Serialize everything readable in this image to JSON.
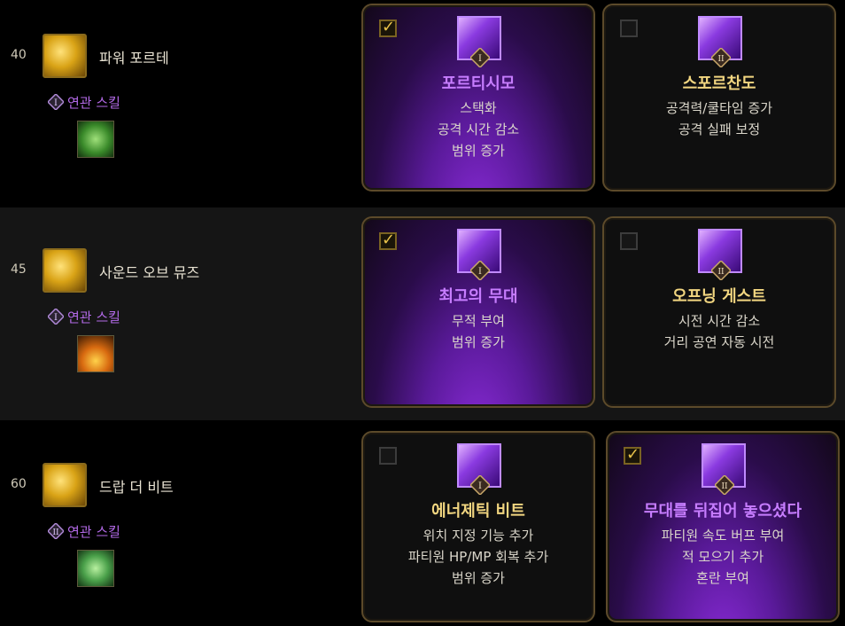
{
  "rows": [
    {
      "level": "40",
      "skill_name": "파워 포르테",
      "related_label": "연관 스킬",
      "related_badge": "I",
      "cards": [
        {
          "selected": true,
          "badge": "I",
          "title": "포르티시모",
          "lines": [
            "스택화",
            "공격 시간 감소",
            "범위 증가"
          ]
        },
        {
          "selected": false,
          "badge": "II",
          "title": "스포르찬도",
          "lines": [
            "공격력/쿨타임 증가",
            "공격 실패 보정"
          ]
        }
      ]
    },
    {
      "level": "45",
      "skill_name": "사운드 오브 뮤즈",
      "related_label": "연관 스킬",
      "related_badge": "I",
      "cards": [
        {
          "selected": true,
          "badge": "I",
          "title": "최고의 무대",
          "lines": [
            "무적 부여",
            "범위 증가"
          ]
        },
        {
          "selected": false,
          "badge": "II",
          "title": "오프닝 게스트",
          "lines": [
            "시전 시간 감소",
            "거리 공연 자동 시전"
          ]
        }
      ]
    },
    {
      "level": "60",
      "skill_name": "드랍 더 비트",
      "related_label": "연관 스킬",
      "related_badge": "II",
      "cards": [
        {
          "selected": false,
          "badge": "I",
          "title": "에너제틱 비트",
          "lines": [
            "위치 지정 기능 추가",
            "파티원 HP/MP 회복 추가",
            "범위 증가"
          ]
        },
        {
          "selected": true,
          "badge": "II",
          "title": "무대를 뒤집어 놓으셨다",
          "lines": [
            "파티원 속도 버프 부여",
            "적 모으기 추가",
            "혼란 부여"
          ]
        }
      ]
    }
  ],
  "colors": {
    "selected_title": "#c77dff",
    "unselected_title": "#f2d680",
    "related_label": "#b36ae8",
    "check": "#e8c24a"
  },
  "icons": {
    "skill": "skill-icon",
    "related": "related-skill-icon",
    "checkbox": "checkbox-icon",
    "badge": "roman-numeral-diamond-icon"
  }
}
